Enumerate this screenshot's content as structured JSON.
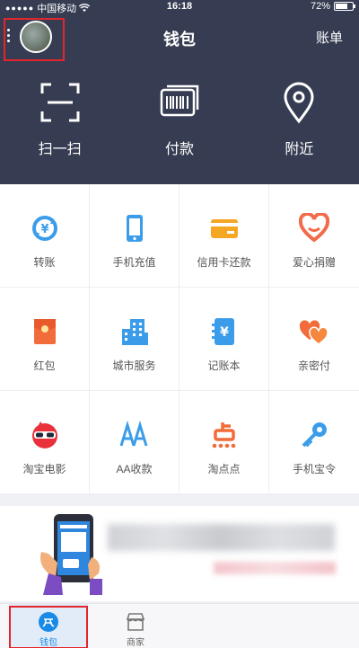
{
  "status_bar": {
    "carrier": "中国移动",
    "time": "16:18",
    "battery_text": "72%",
    "battery_level": 0.72
  },
  "nav": {
    "title": "钱包",
    "right_label": "账单"
  },
  "quick_actions": [
    {
      "label": "扫一扫",
      "icon": "scan-icon"
    },
    {
      "label": "付款",
      "icon": "barcode-pay-icon"
    },
    {
      "label": "附近",
      "icon": "location-pin-icon"
    }
  ],
  "grid": [
    {
      "label": "转账",
      "icon": "transfer-icon",
      "color": "#3b9dea"
    },
    {
      "label": "手机充值",
      "icon": "phone-recharge-icon",
      "color": "#3b9dea"
    },
    {
      "label": "信用卡还款",
      "icon": "credit-card-icon",
      "color": "#f5a623"
    },
    {
      "label": "爱心捐赠",
      "icon": "heart-donate-icon",
      "color": "#f26b4a"
    },
    {
      "label": "红包",
      "icon": "red-envelope-icon",
      "color": "#f26b3a"
    },
    {
      "label": "城市服务",
      "icon": "city-building-icon",
      "color": "#3b9dea"
    },
    {
      "label": "记账本",
      "icon": "account-book-icon",
      "color": "#3b9dea"
    },
    {
      "label": "亲密付",
      "icon": "hearts-icon",
      "color": "#f26b3a"
    },
    {
      "label": "淘宝电影",
      "icon": "taobao-movie-icon",
      "color": "#e8313a"
    },
    {
      "label": "AA收款",
      "icon": "aa-collect-icon",
      "color": "#3b9dea"
    },
    {
      "label": "淘点点",
      "icon": "taodiandian-icon",
      "color": "#f26b3a"
    },
    {
      "label": "手机宝令",
      "icon": "key-icon",
      "color": "#3b9dea"
    }
  ],
  "tabbar": [
    {
      "label": "钱包",
      "icon": "alipay-wallet-icon",
      "active": true
    },
    {
      "label": "商家",
      "icon": "store-icon",
      "active": false
    }
  ],
  "colors": {
    "header_bg": "#363d52",
    "accent": "#1a8ae6",
    "highlight_frame": "#e3262b"
  }
}
